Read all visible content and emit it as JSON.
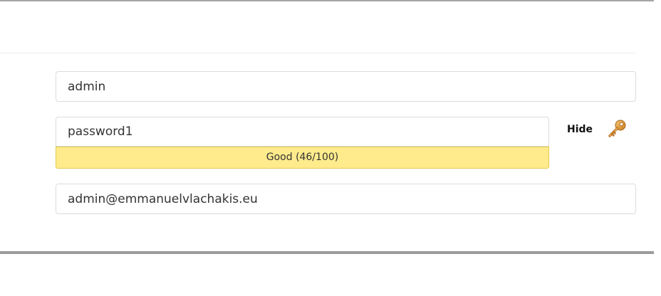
{
  "form": {
    "username": {
      "value": "admin"
    },
    "password": {
      "value": "password1"
    },
    "strength": {
      "label": "Good (46/100)",
      "score": 46,
      "max": 100,
      "color": "#ffeb8c"
    },
    "toggle": {
      "label": "Hide",
      "icon": "key-icon"
    },
    "email": {
      "value": "admin@emmanuelvlachakis.eu"
    }
  }
}
